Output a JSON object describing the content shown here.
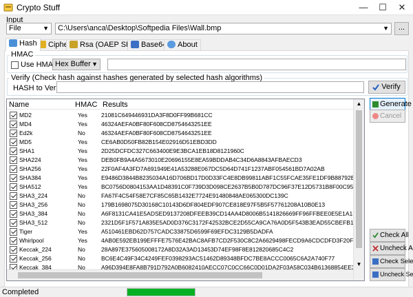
{
  "window": {
    "title": "Crypto Stuff"
  },
  "input": {
    "group_label": "Input",
    "source_type": "File",
    "path": "C:\\Users\\anca\\Desktop\\Softpedia Files\\Wall.bmp",
    "browse_label": "..."
  },
  "tabs": [
    {
      "label": "Hash",
      "icon": "hash-icon"
    },
    {
      "label": "Cipher",
      "icon": "lock-icon"
    },
    {
      "label": "Rsa (OAEP SHA1)",
      "icon": "key-icon"
    },
    {
      "label": "Base64",
      "icon": "base64-icon"
    },
    {
      "label": "About",
      "icon": "info-icon"
    }
  ],
  "hmac": {
    "group_label": "HMAC",
    "use_label": "Use HMAC",
    "use_checked": false,
    "key_format": "Hex Buffer",
    "key_value": ""
  },
  "verify": {
    "group_label": "Verify (Check hash against hashes generated by selected hash algorithms)",
    "field_label": "HASH to Verify",
    "value": "",
    "button": "Verify"
  },
  "list": {
    "columns": {
      "name": "Name",
      "hmac": "HMAC",
      "results": "Results"
    },
    "rows": [
      {
        "name": "MD2",
        "hmac": "Yes",
        "result": "21081C649446931DA3F8D0FF99B681CC",
        "checked": true
      },
      {
        "name": "MD4",
        "hmac": "Yes",
        "result": "46324AEFA0BF80F608CD8754643251EE",
        "checked": true
      },
      {
        "name": "Ed2k",
        "hmac": "No",
        "result": "46324AEFA0BF80F608CD8754643251EE",
        "checked": true
      },
      {
        "name": "MD5",
        "hmac": "Yes",
        "result": "CE6AB0D50FB82B154E02916D51EBD3DD",
        "checked": true
      },
      {
        "name": "SHA1",
        "hmac": "Yes",
        "result": "2D25DCFDC327C663400E9E3BCA1EB18D8121960C",
        "checked": true
      },
      {
        "name": "SHA224",
        "hmac": "Yes",
        "result": "DEB0FB9A4A5673010E20696155E8EA59BDDAB4C34D6A8843AFBAECD3",
        "checked": true
      },
      {
        "name": "SHA256",
        "hmac": "Yes",
        "result": "22F0AF4A3FD7A691949E41A53288E067DC5D64D741F1237ABF054561BD7A02AB",
        "checked": true
      },
      {
        "name": "SHA384",
        "hmac": "Yes",
        "result": "E9486D3844B8235034A16D706BD17D0D33FC4E8DB99811ABF1C55FCAE35FE1DF9B88792E...",
        "checked": true
      },
      {
        "name": "SHA512",
        "hmac": "Yes",
        "result": "BC0756D0804153AA1D48391C0F739D3D098CE2637B5B0D787DC96F37E12D5731B8F00C95...",
        "checked": true
      },
      {
        "name": "SHA3_224",
        "hmac": "No",
        "result": "FA67F4C54F58E7CF85C65B1432E7724E91480848AE065300DC139C",
        "checked": true
      },
      {
        "name": "SHA3_256",
        "hmac": "No",
        "result": "179B1698075D30168C10143D6DF804EDF907CE818E97F5B5F57761208A10B0E13",
        "checked": true
      },
      {
        "name": "SHA3_384",
        "hmac": "No",
        "result": "A6F8131CA41E5ADSED9137208DFEEB39CD14AA4D8006B5141826669FF96FFBEE0E5E1A1F2...",
        "checked": true
      },
      {
        "name": "SHA3_512",
        "hmac": "No",
        "result": "2321D5F1F571A835E5AD0D376C3172F42532BCE2D55CA9CA76A0D5F543B3EAD55CBEFB15A...",
        "checked": true
      },
      {
        "name": "Tiger",
        "hmac": "Yes",
        "result": "A510461EBD62D757CADC33875D6599F69EFDC3129B5DADFA",
        "checked": true
      },
      {
        "name": "Whirlpool",
        "hmac": "Yes",
        "result": "4AB0E592EB199EFFFE7576E42BAC8AFB7CD2F530C8C2A6629498FECD9A6CDCDFD3F20F71F3...",
        "checked": true
      },
      {
        "name": "Keccak_224",
        "hmac": "No",
        "result": "28A897E375605008172A8D32A3AD13453D74EF98F8E812820685C4C2",
        "checked": true
      },
      {
        "name": "Keccak_256",
        "hmac": "No",
        "result": "BC6E4C49F34C4249FEF0398293AC51462D89348BFDC7BE8ACCC0065C6A2A740F77",
        "checked": true
      },
      {
        "name": "Keccak_384",
        "hmac": "No",
        "result": "A96D394E8FA8B791D792A0B6082410AECC07C0CC66C0D01DA2F03A58C034B61368854EE3...",
        "checked": true
      },
      {
        "name": "Keccak_512",
        "hmac": "No",
        "result": "DE42DDF3D7A8A863F9E8ABC6958EDC9FCE09E3F3DA04B95F34B2577F3F9262FEF2D72ED7...",
        "checked": true
      },
      {
        "name": "RIPEMD128",
        "hmac": "Yes",
        "result": "C533CA3C09E546D5CB773951B5D93940",
        "checked": true
      }
    ]
  },
  "actions": {
    "generate": "Generate",
    "cancel": "Cancel",
    "check_all": "Check All",
    "uncheck_all": "Uncheck All",
    "check_selected": "Check Selected",
    "uncheck_selected": "Uncheck Selected"
  },
  "status": {
    "text": "Completed",
    "progress": 1.0
  },
  "colors": {
    "accent": "#0078d7",
    "progress": "#06b025",
    "generate_icon": "#2e8b2e"
  }
}
